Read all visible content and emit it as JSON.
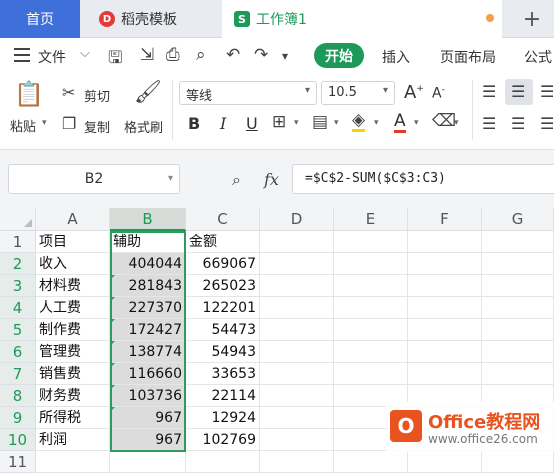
{
  "tabs": {
    "home": "首页",
    "template": "稻壳模板",
    "template_logo": "D",
    "workbook": "工作簿1",
    "workbook_logo": "S",
    "add": "+"
  },
  "menu": {
    "file": "文件",
    "start": "开始",
    "insert": "插入",
    "page_layout": "页面布局",
    "formula": "公式"
  },
  "ribbon": {
    "paste": "粘贴",
    "cut": "剪切",
    "copy": "复制",
    "format_painter": "格式刷",
    "font_name": "等线",
    "font_size": "10.5",
    "bold": "B",
    "italic": "I",
    "underline": "U",
    "grow_font": "A",
    "shrink_font": "A",
    "font_color": "A"
  },
  "formula_bar": {
    "name_box": "B2",
    "fx": "fx",
    "formula": "=$C$2-SUM($C$3:C3)"
  },
  "sheet": {
    "columns": [
      "A",
      "B",
      "C",
      "D",
      "E",
      "F",
      "G"
    ],
    "rows": [
      {
        "num": "1",
        "a": "项目",
        "b": "辅助",
        "c": "金额"
      },
      {
        "num": "2",
        "a": "收入",
        "b": "404044",
        "c": "669067"
      },
      {
        "num": "3",
        "a": "材料费",
        "b": "281843",
        "c": "265023"
      },
      {
        "num": "4",
        "a": "人工费",
        "b": "227370",
        "c": "122201"
      },
      {
        "num": "5",
        "a": "制作费",
        "b": "172427",
        "c": "54473"
      },
      {
        "num": "6",
        "a": "管理费",
        "b": "138774",
        "c": "54943"
      },
      {
        "num": "7",
        "a": "销售费",
        "b": "116660",
        "c": "33653"
      },
      {
        "num": "8",
        "a": "财务费",
        "b": "103736",
        "c": "22114"
      },
      {
        "num": "9",
        "a": "所得税",
        "b": "967",
        "c": "12924"
      },
      {
        "num": "10",
        "a": "利润",
        "b": "967",
        "c": "102769"
      },
      {
        "num": "11",
        "a": "",
        "b": "",
        "c": ""
      }
    ]
  },
  "watermark": {
    "logo": "O",
    "title": "Office教程网",
    "url": "www.office26.com"
  },
  "colors": {
    "accent": "#1d9a5a",
    "home_tab": "#3f6fd8",
    "watermark": "#e8531f"
  }
}
